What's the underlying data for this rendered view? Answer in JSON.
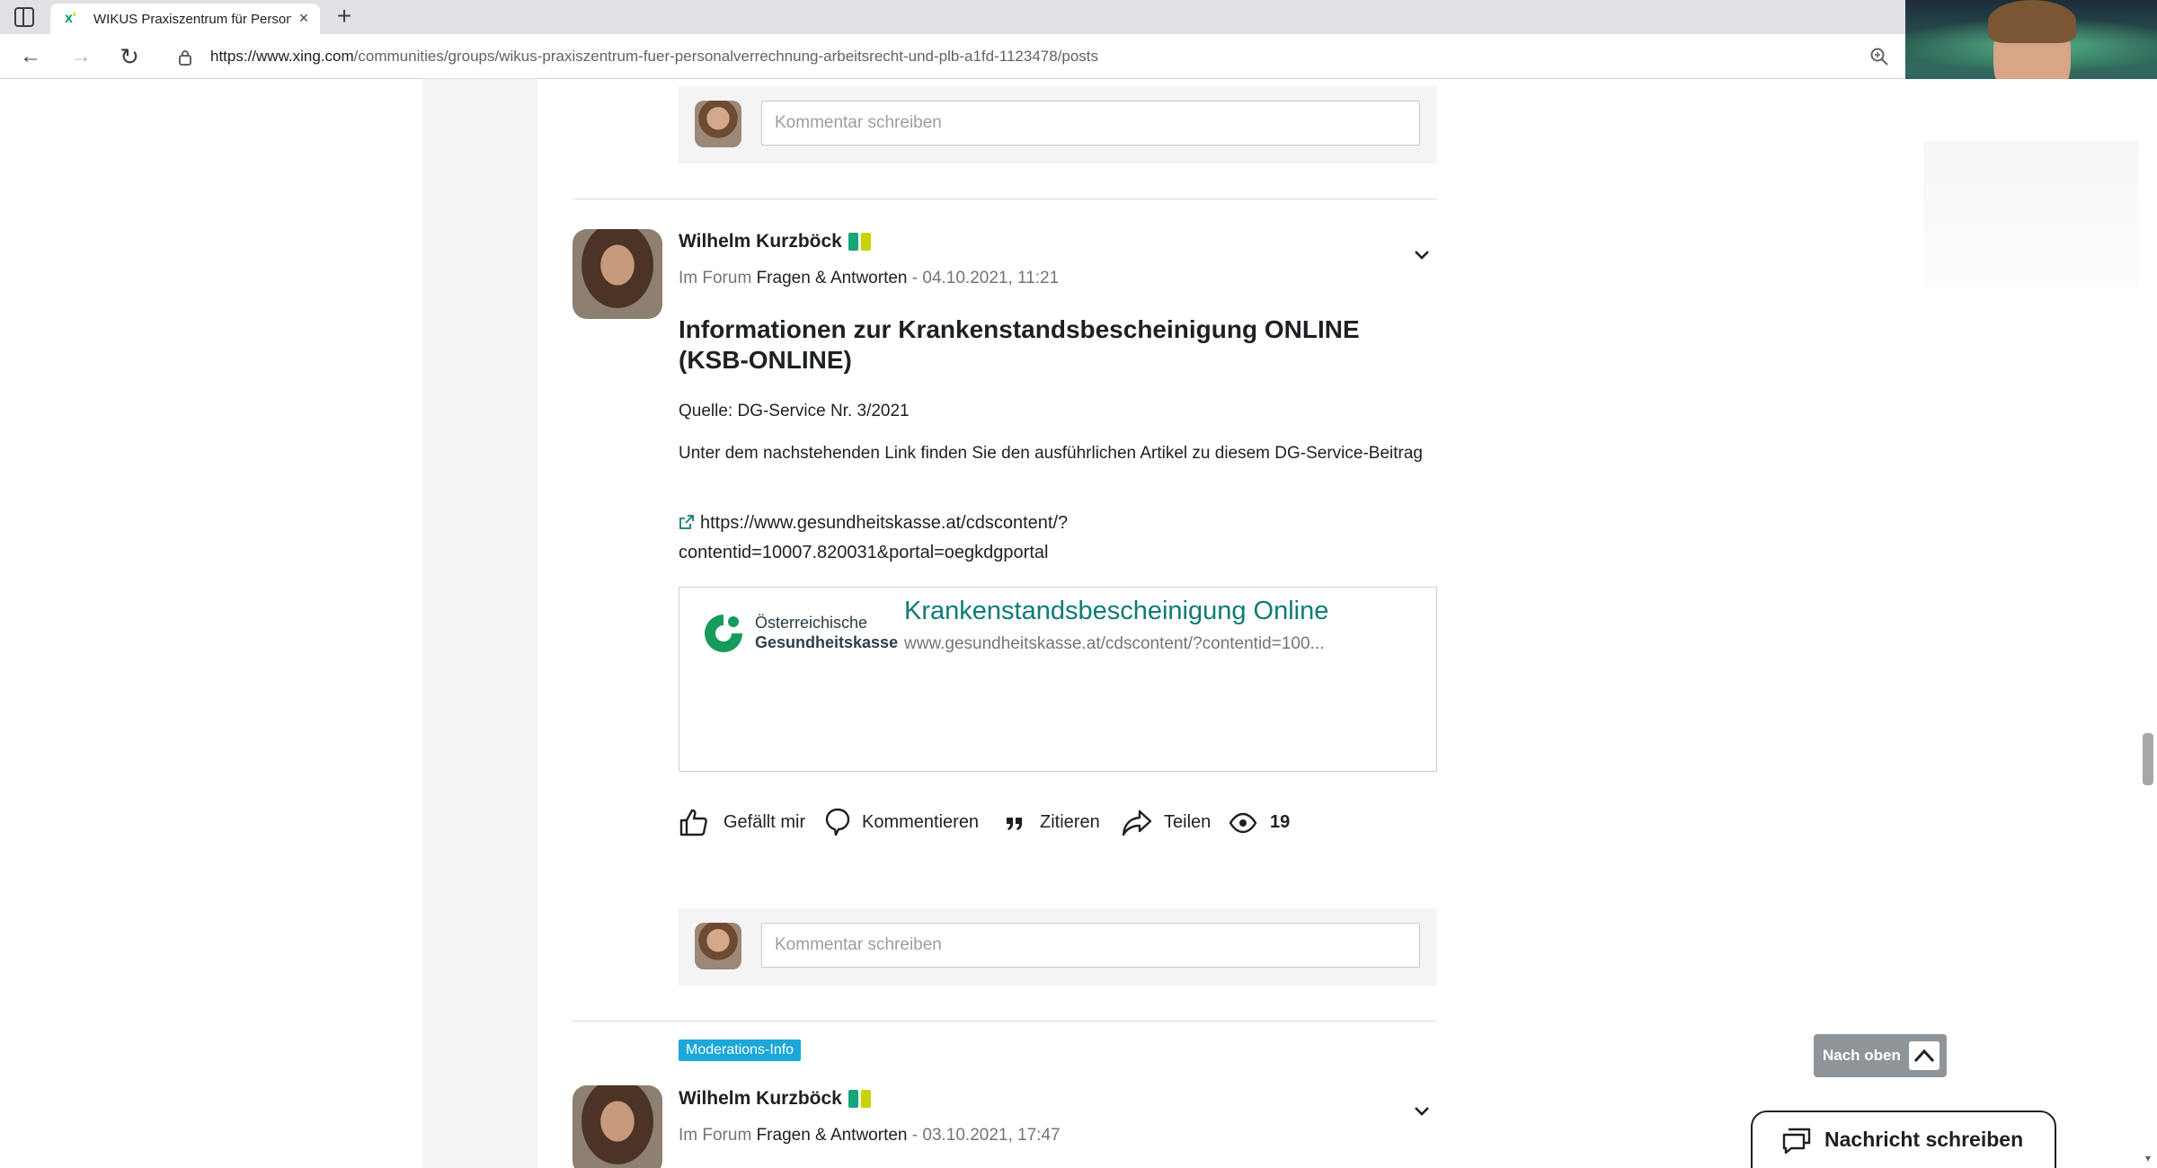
{
  "browser": {
    "tab_title": "WIKUS Praxiszentrum für Personalverrechnung",
    "tab_close": "×",
    "new_tab": "+",
    "url_host": "https://www.xing.com",
    "url_path": "/communities/groups/wikus-praxiszentrum-fuer-personalverrechnung-arbeitsrecht-und-plb-a1fd-1123478/posts"
  },
  "comment": {
    "placeholder": "Kommentar schreiben"
  },
  "posts": [
    {
      "author": "Wilhelm Kurzböck",
      "forum_prefix": "Im Forum",
      "forum_name": "Fragen & Antworten",
      "date": "- 04.10.2021, 11:21",
      "title": "Informationen zur Krankenstandsbescheinigung ONLINE (KSB-ONLINE)",
      "source": "Quelle: DG-Service Nr. 3/2021",
      "body": "Unter dem nachstehenden Link finden Sie den ausführlichen Artikel zu diesem DG-Service-Beitrag",
      "link_line1": "https://www.gesundheitskasse.at/cdscontent/?",
      "link_line2": "contentid=10007.820031&portal=oegkdgportal",
      "card": {
        "logo_line1": "Österreichische",
        "logo_line2": "Gesundheitskasse",
        "title": "Krankenstandsbescheinigung Online",
        "url": "www.gesundheitskasse.at/cdscontent/?contentid=100..."
      },
      "actions": {
        "like": "Gefällt mir",
        "comment": "Kommentieren",
        "quote": "Zitieren",
        "share": "Teilen",
        "views": "19"
      }
    },
    {
      "badge": "Moderations-Info",
      "author": "Wilhelm Kurzböck",
      "forum_prefix": "Im Forum",
      "forum_name": "Fragen & Antworten",
      "date": "- 03.10.2021, 17:47"
    }
  ],
  "floating": {
    "back_to_top": "Nach oben",
    "write_message": "Nachricht schreiben"
  },
  "colors": {
    "accent_teal": "#0e7b74",
    "badge_blue": "#1ba7d8",
    "xing_green": "#15a577",
    "xing_lime": "#c7d400"
  }
}
